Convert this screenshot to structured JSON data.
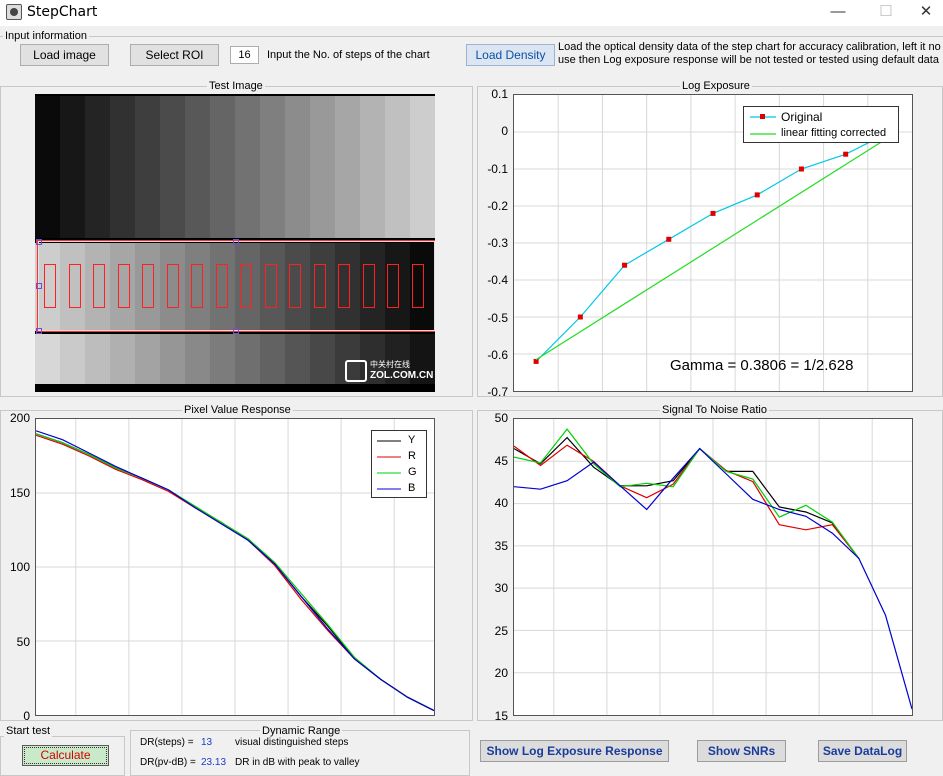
{
  "window": {
    "title": "StepChart",
    "minimize": "—",
    "maximize": "☐",
    "close": "✕"
  },
  "input_info": {
    "group_title": "Input information",
    "load_image": "Load image",
    "select_roi": "Select ROI",
    "steps_value": "16",
    "steps_label": "Input the No. of steps of the chart",
    "load_density": "Load Density",
    "density_note_1": "Load the optical density data of the step chart for accuracy calibration, left it no",
    "density_note_2": "use then Log exposure response will be not tested or tested using default data"
  },
  "test_image": {
    "title": "Test Image",
    "watermark_line1": "中关村在线",
    "watermark_line2": "ZOL.COM.CN"
  },
  "log_exposure": {
    "title": "Log Exposure",
    "y_ticks": [
      "0.1",
      "0",
      "-0.1",
      "-0.2",
      "-0.3",
      "-0.4",
      "-0.5",
      "-0.6",
      "-0.7"
    ],
    "gamma_text": "Gamma = 0.3806 = 1/2.628",
    "legend": [
      "Original",
      "linear fitting corrected"
    ]
  },
  "pixel_response": {
    "title": "Pixel Value Response",
    "y_ticks": [
      "200",
      "150",
      "100",
      "50",
      "0"
    ],
    "legend": [
      "Y",
      "R",
      "G",
      "B"
    ]
  },
  "snr": {
    "title": "Signal To Noise Ratio",
    "y_ticks": [
      "50",
      "45",
      "40",
      "35",
      "30",
      "25",
      "20",
      "15"
    ]
  },
  "start_test": {
    "group_title": "Start test",
    "calculate": "Calculate"
  },
  "dynamic_range": {
    "group_title": "Dynamic Range",
    "steps_label": "DR(steps)  =",
    "steps_value": "13",
    "steps_desc": "visual distinguished steps",
    "pv_label": "DR(pv-dB)  =",
    "pv_value": "23.13",
    "pv_desc": "DR in dB with peak to valley"
  },
  "actions": {
    "show_log": "Show Log Exposure Response",
    "show_snr": "Show SNRs",
    "save_log": "Save DataLog"
  },
  "colors": {
    "Y": "#000000",
    "R": "#e00000",
    "G": "#00d000",
    "B": "#0000d0",
    "original": "#00c8e8",
    "fit": "#22dd22",
    "marker": "#e00000"
  },
  "chart_data": [
    {
      "type": "line",
      "title": "Log Exposure",
      "ylim": [
        -0.7,
        0.1
      ],
      "series": [
        {
          "name": "Original",
          "x": [
            1,
            2,
            3,
            4,
            5,
            6,
            7,
            8,
            9
          ],
          "values": [
            -0.62,
            -0.5,
            -0.36,
            -0.29,
            -0.22,
            -0.17,
            -0.1,
            -0.06,
            0.0
          ]
        },
        {
          "name": "linear fitting corrected",
          "x": [
            1,
            8.9
          ],
          "values": [
            -0.615,
            -0.02
          ]
        }
      ],
      "annotation": "Gamma = 0.3806 = 1/2.628"
    },
    {
      "type": "line",
      "title": "Pixel Value Response",
      "ylim": [
        0,
        200
      ],
      "x": [
        1,
        2,
        3,
        4,
        5,
        6,
        7,
        8,
        9,
        10,
        11,
        12,
        13,
        14,
        15,
        16
      ],
      "series": [
        {
          "name": "Y",
          "values": [
            190,
            184,
            176,
            167,
            160,
            152,
            140,
            130,
            118,
            102,
            80,
            60,
            38,
            24,
            12,
            3
          ]
        },
        {
          "name": "R",
          "values": [
            189,
            183,
            175,
            166,
            159,
            151,
            140,
            130,
            118,
            101,
            78,
            57,
            38,
            24,
            12,
            3
          ]
        },
        {
          "name": "G",
          "values": [
            190,
            184,
            176,
            167,
            160,
            152,
            141,
            130,
            119,
            103,
            82,
            61,
            39,
            24,
            12,
            3
          ]
        },
        {
          "name": "B",
          "values": [
            192,
            186,
            177,
            168,
            160,
            152,
            140,
            129,
            118,
            102,
            80,
            58,
            38,
            24,
            12,
            3
          ]
        }
      ]
    },
    {
      "type": "line",
      "title": "Signal To Noise Ratio",
      "ylim": [
        15,
        50
      ],
      "x": [
        1,
        2,
        3,
        4,
        5,
        6,
        7,
        8,
        9,
        10,
        11,
        12,
        13,
        14,
        15,
        16
      ],
      "series": [
        {
          "name": "Y",
          "values": [
            46.5,
            44.7,
            47.8,
            44.3,
            42.1,
            42.1,
            42.7,
            46.5,
            43.8,
            43.8,
            39.6,
            39.0,
            37.7,
            33.5,
            null,
            null
          ]
        },
        {
          "name": "R",
          "values": [
            46.8,
            44.5,
            46.9,
            45.0,
            42.1,
            40.7,
            42.3,
            46.5,
            43.9,
            42.6,
            37.5,
            36.9,
            37.5,
            33.5,
            null,
            null
          ]
        },
        {
          "name": "G",
          "values": [
            45.5,
            44.8,
            48.8,
            44.7,
            42.0,
            42.4,
            42.0,
            46.5,
            43.8,
            42.9,
            38.4,
            39.8,
            37.8,
            33.5,
            null,
            null
          ]
        },
        {
          "name": "B",
          "values": [
            42.0,
            41.7,
            42.7,
            44.9,
            42.1,
            39.3,
            43.0,
            46.5,
            43.5,
            40.5,
            39.3,
            38.5,
            36.5,
            33.5,
            26.8,
            15.7
          ]
        }
      ]
    }
  ]
}
